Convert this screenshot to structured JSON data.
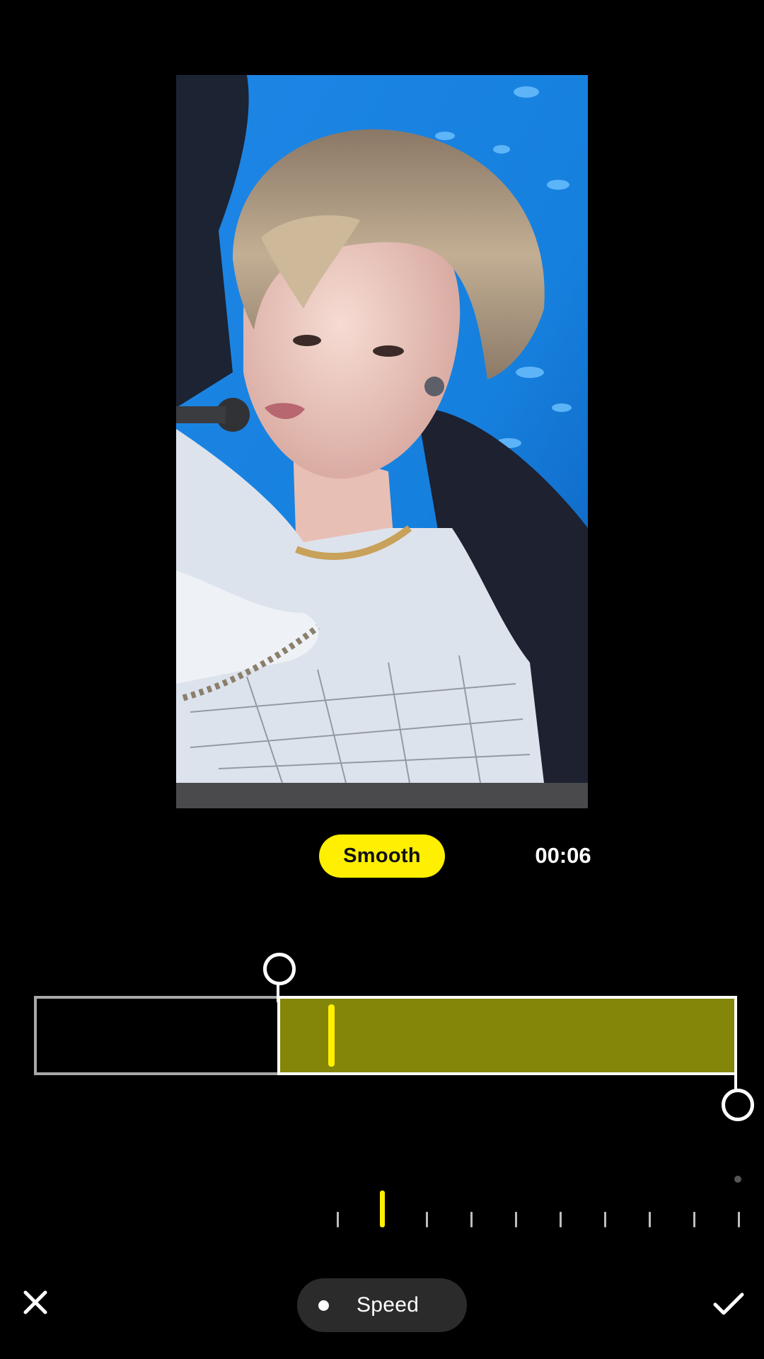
{
  "preview": {
    "description_icon": "video-preview",
    "colors": {
      "background": "#1f8ce8",
      "hair": "#b9a68d",
      "skin": "#f1d2c8",
      "jacket": "#dfe6ef",
      "dark_figure": "#202330"
    }
  },
  "controls": {
    "mode_label": "Smooth",
    "time": "00:06",
    "accent_color": "#ffef00",
    "selected_color": "#838608"
  },
  "timeline": {
    "selection_start_fraction": 0.346,
    "selection_end_fraction": 1.0,
    "playhead_fraction": 0.42
  },
  "scale": {
    "tick_count": 10,
    "active_tick_index": 1
  },
  "bottom_bar": {
    "close_icon": "close-icon",
    "confirm_icon": "check-icon",
    "mode_label": "Speed"
  }
}
